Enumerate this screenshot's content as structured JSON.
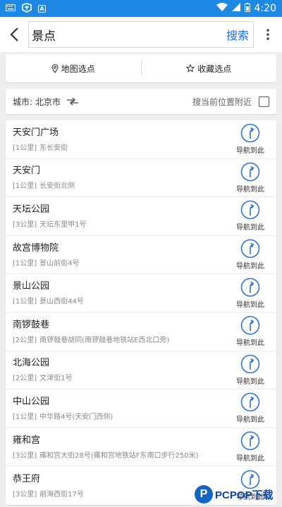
{
  "status_bar": {
    "time": "4:20",
    "left_icons": [
      "keyboard-icon",
      "app-icon",
      "a-icon"
    ],
    "right_icons": [
      "wifi-icon",
      "signal-icon",
      "battery-icon"
    ]
  },
  "search": {
    "value": "景点",
    "button_label": "搜索"
  },
  "pick": {
    "map_label": "地图选点",
    "favorites_label": "收藏选点"
  },
  "city": {
    "label": "城市:",
    "value": "北京市",
    "nearby_label": "搜当前位置附近",
    "nearby_checked": false
  },
  "nav_label": "导航到此",
  "results": [
    {
      "name": "天安门广场",
      "distance": "[1公里]",
      "address": "东长安街"
    },
    {
      "name": "天安门",
      "distance": "[1公里]",
      "address": "长安街北侧"
    },
    {
      "name": "天坛公园",
      "distance": "[3公里]",
      "address": "天坛东里甲1号"
    },
    {
      "name": "故宫博物院",
      "distance": "[1公里]",
      "address": "景山前街4号"
    },
    {
      "name": "景山公园",
      "distance": "[1公里]",
      "address": "景山西街44号"
    },
    {
      "name": "南锣鼓巷",
      "distance": "[2公里]",
      "address": "南锣鼓巷胡同(南锣鼓巷地铁站E西北口旁)"
    },
    {
      "name": "北海公园",
      "distance": "[2公里]",
      "address": "文津街1号"
    },
    {
      "name": "中山公园",
      "distance": "[1公里]",
      "address": "中华路4号(天安门西侧)"
    },
    {
      "name": "雍和宫",
      "distance": "[3公里]",
      "address": "雍和宫大街28号(雍和宫地铁站F东南口步行250米)"
    },
    {
      "name": "恭王府",
      "distance": "[3公里]",
      "address": "前海西街17号"
    }
  ],
  "watermark": {
    "logo_letter": "P",
    "text": "PCPOP下载"
  },
  "colors": {
    "status_bar": "#1e88e5",
    "accent": "#1e6fd9",
    "nav_icon": "#2a73d8"
  }
}
